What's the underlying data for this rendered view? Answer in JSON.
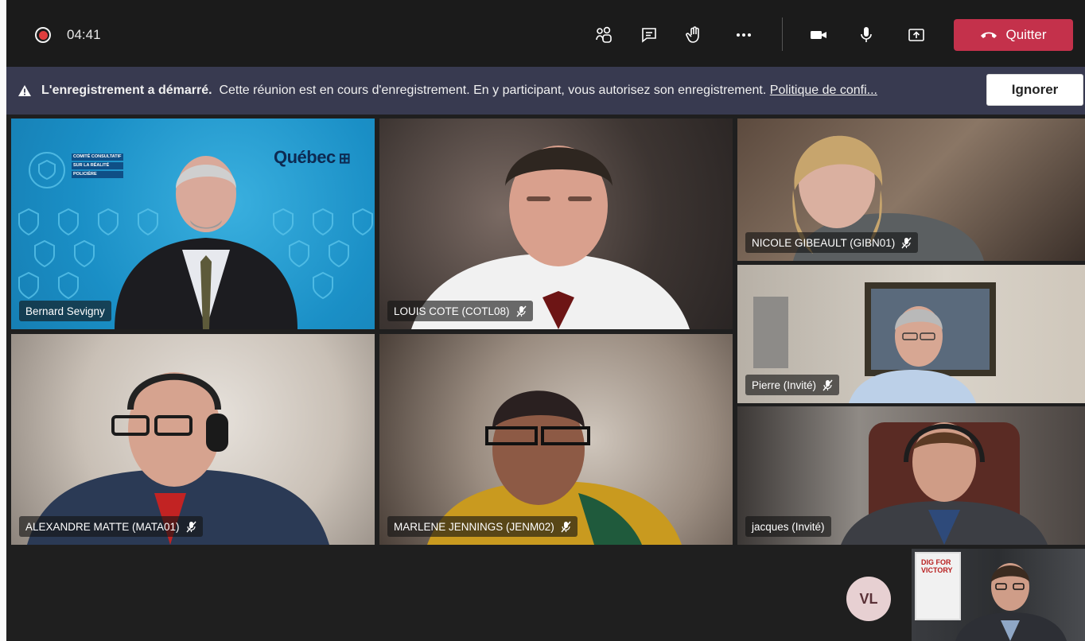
{
  "meeting": {
    "recording_time": "04:41"
  },
  "controls": {
    "participants_icon": "people-icon",
    "chat_icon": "chat-icon",
    "raise_hand_icon": "hand-icon",
    "more_icon": "more-icon",
    "camera_icon": "camera-icon",
    "mic_icon": "mic-icon",
    "share_icon": "share-icon",
    "leave_label": "Quitter",
    "leave_color": "#c4314b"
  },
  "banner": {
    "title": "L'enregistrement a démarré.",
    "message": "Cette réunion est en cours d'enregistrement. En y participant, vous autorisez son enregistrement.",
    "link": "Politique de confi...",
    "ignore_label": "Ignorer",
    "background": "#383a50"
  },
  "tiles": {
    "bernard": {
      "name": "Bernard Sevigny",
      "brand": "Québec",
      "committee": [
        "COMITÉ CONSULTATIF",
        "SUR LA RÉALITÉ",
        "POLICIÈRE"
      ]
    },
    "louis": {
      "name": "LOUIS COTE (COTL08)",
      "muted": true
    },
    "nicole": {
      "name": "NICOLE GIBEAULT (GIBN01)",
      "muted": true
    },
    "pierre": {
      "name": "Pierre (Invité)",
      "muted": true
    },
    "alexandre": {
      "name": "ALEXANDRE MATTE (MATA01)",
      "muted": true
    },
    "marlene": {
      "name": "MARLENE JENNINGS (JENM02)",
      "muted": true
    },
    "jacques": {
      "name": "jacques (Invité)",
      "muted": false
    }
  },
  "self_view": {
    "avatar_initials": "VL",
    "poster_text": "DIG FOR VICTORY"
  }
}
